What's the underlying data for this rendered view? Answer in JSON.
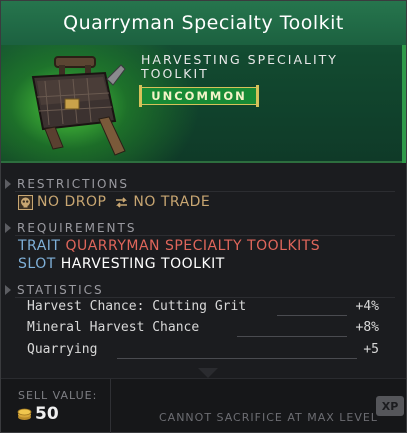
{
  "item": {
    "title": "Quarryman Specialty Toolkit",
    "type_line_1": "HARVESTING SPECIALITY",
    "type_line_2": "TOOLKIT",
    "rarity": "UNCOMMON",
    "image_icon": "toolkit-icon"
  },
  "restrictions": {
    "label": "RESTRICTIONS",
    "no_drop": "NO DROP",
    "no_trade": "NO TRADE",
    "no_drop_icon": "skull-icon",
    "no_trade_icon": "trade-arrows-icon"
  },
  "requirements": {
    "label": "REQUIREMENTS",
    "trait_key": "TRAIT",
    "trait_value": "QUARRYMAN SPECIALTY TOOLKITS",
    "slot_key": "SLOT",
    "slot_value": "HARVESTING TOOLKIT"
  },
  "statistics": {
    "label": "STATISTICS",
    "rows": [
      {
        "name": "Harvest Chance: Cutting Grit",
        "value": "+4%"
      },
      {
        "name": "Mineral Harvest Chance",
        "value": "+8%"
      },
      {
        "name": "Quarrying",
        "value": "+5"
      }
    ]
  },
  "footer": {
    "sell_label": "SELL VALUE:",
    "sell_value": "50",
    "sacrifice_text": "CANNOT SACRIFICE AT MAX LEVEL",
    "xp_badge": "XP"
  },
  "colors": {
    "rarity_green": "#178a35",
    "header_green": "#1c6140",
    "trait_red": "#e0665b",
    "key_blue": "#7fb0d8",
    "restriction_gold": "#c8a672"
  }
}
